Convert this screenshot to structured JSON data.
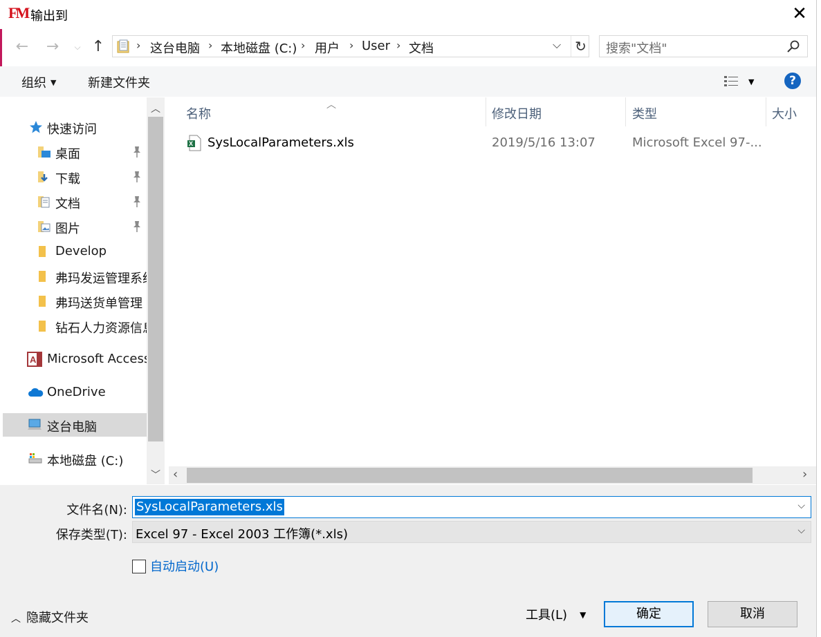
{
  "window": {
    "title": "输出到",
    "app_logo": "FM",
    "close_icon": "close-icon"
  },
  "address": {
    "crumbs": [
      "这台电脑",
      "本地磁盘 (C:)",
      "用户",
      "User",
      "文档"
    ],
    "search_placeholder": "搜索\"文档\""
  },
  "toolbar": {
    "organize": "组织",
    "new_folder": "新建文件夹",
    "help": "?"
  },
  "nav": {
    "quick_access": "快速访问",
    "items": [
      "桌面",
      "下载",
      "文档",
      "图片",
      "Develop",
      "弗玛发运管理系统",
      "弗玛送货单管理",
      "钻石人力资源信息"
    ],
    "access": "Microsoft Access",
    "onedrive": "OneDrive",
    "this_pc": "这台电脑",
    "local_disk": "本地磁盘 (C:)"
  },
  "list": {
    "columns": [
      "名称",
      "修改日期",
      "类型",
      "大小"
    ],
    "rows": [
      {
        "name": "SysLocalParameters.xls",
        "modified": "2019/5/16 13:07",
        "type": "Microsoft Excel 97-..."
      }
    ]
  },
  "form": {
    "filename_label": "文件名(N):",
    "filename_value": "SysLocalParameters.xls",
    "filetype_label": "保存类型(T):",
    "filetype_value": "Excel 97 - Excel 2003 工作簿(*.xls)",
    "autostart_label": "自动启动(U)",
    "autostart_checked": false
  },
  "footer": {
    "hide_folders": "隐藏文件夹",
    "tools": "工具(L)",
    "ok": "确定",
    "cancel": "取消"
  },
  "colors": {
    "accent": "#0078d7",
    "selected_nav": "#d9d9d9",
    "panel_bg": "#f0f0f0"
  }
}
